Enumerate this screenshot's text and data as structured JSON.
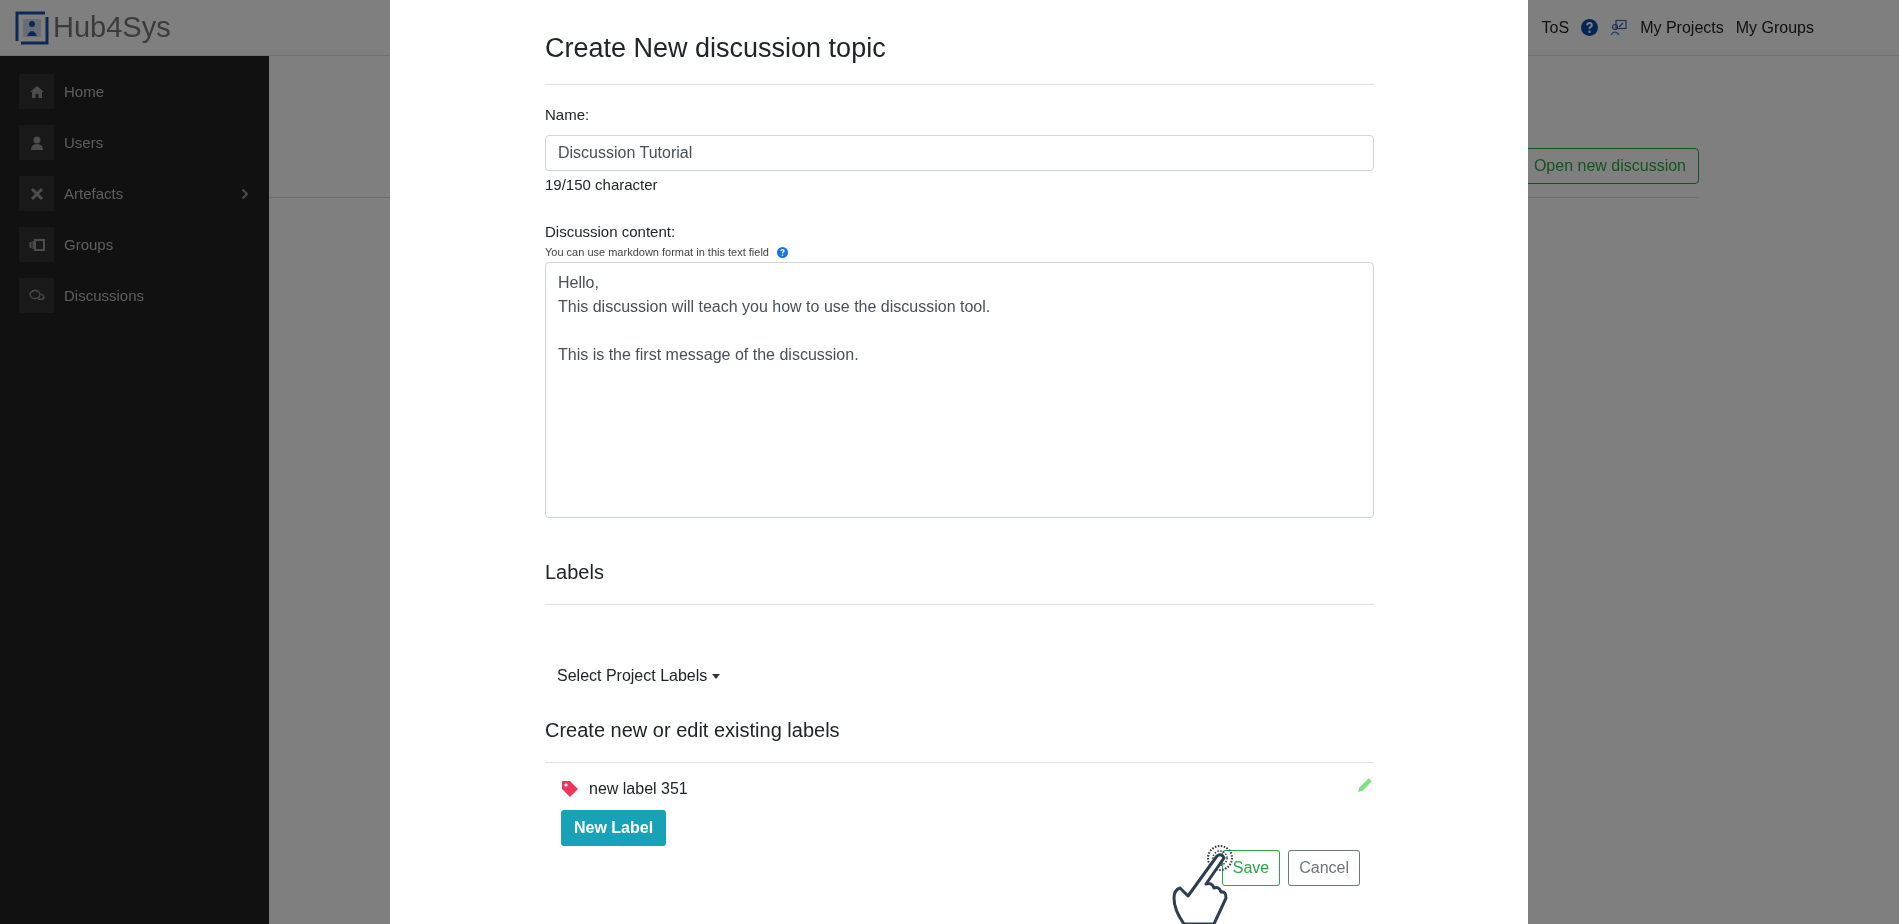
{
  "header": {
    "logo": "Hub4Sys",
    "nav_links": [
      "ToS",
      "My Projects",
      "My Groups"
    ]
  },
  "sidebar": {
    "items": [
      {
        "label": "Home",
        "kind": "home",
        "expandable": false
      },
      {
        "label": "Users",
        "kind": "user",
        "expandable": false
      },
      {
        "label": "Artefacts",
        "kind": "tools",
        "expandable": true
      },
      {
        "label": "Groups",
        "kind": "groups",
        "expandable": false
      },
      {
        "label": "Discussions",
        "kind": "chat",
        "expandable": false
      }
    ]
  },
  "page": {
    "open_button": "Open new discussion"
  },
  "modal": {
    "title": "Create New discussion topic",
    "name_label": "Name:",
    "name_value": "Discussion Tutorial",
    "name_counter": "19/150 character",
    "content_label": "Discussion content:",
    "content_hint": "You can use markdown format in this text field",
    "content_value": "Hello,\nThis discussion will teach you how to use the discussion tool.\n\nThis is the first message of the discussion.",
    "labels_heading": "Labels",
    "select_labels": "Select Project Labels",
    "create_heading": "Create new or edit existing labels",
    "labels": [
      {
        "name": "new label 351",
        "color": "#f0365a"
      }
    ],
    "new_label_button": "New Label",
    "buttons": [
      {
        "label": "Save",
        "kind": "primary"
      },
      {
        "label": "Cancel",
        "kind": "secondary"
      }
    ]
  }
}
